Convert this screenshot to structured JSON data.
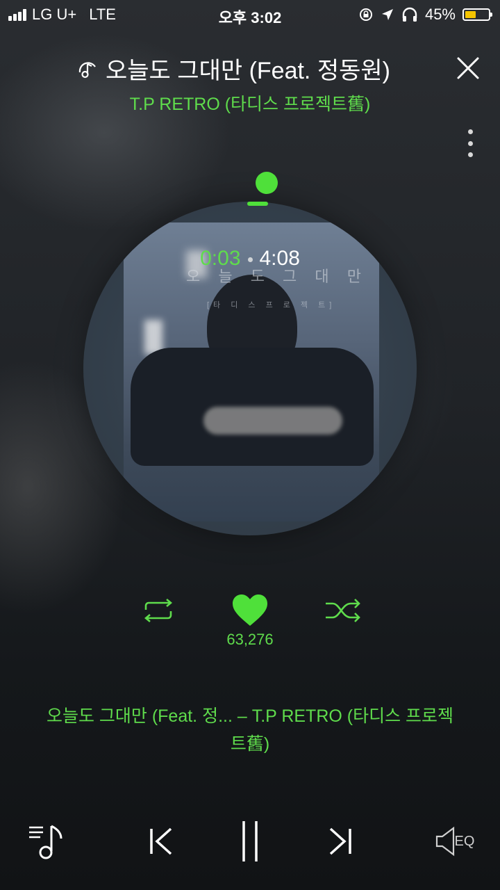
{
  "status_bar": {
    "carrier": "LG U+",
    "network": "LTE",
    "time": "오후 3:02",
    "battery": "45%"
  },
  "header": {
    "title": "오늘도 그대만 (Feat. 정동원)",
    "artist": "T.P RETRO (타디스 프로젝트舊)"
  },
  "player": {
    "elapsed": "0:03",
    "duration": "4:08",
    "progress_fraction": 0.012,
    "likes": "63,276"
  },
  "album_art": {
    "title_text": "오 늘 도  그 대 만",
    "sub_text": "[타 디 스  프 로 젝 트]"
  },
  "now_playing": {
    "line1": "오늘도 그대만 (Feat. 정... – T.P RETRO (타디스 프로젝",
    "line2": "트舊)"
  },
  "controls": {
    "eq_label": "EQ"
  },
  "colors": {
    "accent": "#5fdc4c",
    "battery_fill": "#f4c400"
  }
}
